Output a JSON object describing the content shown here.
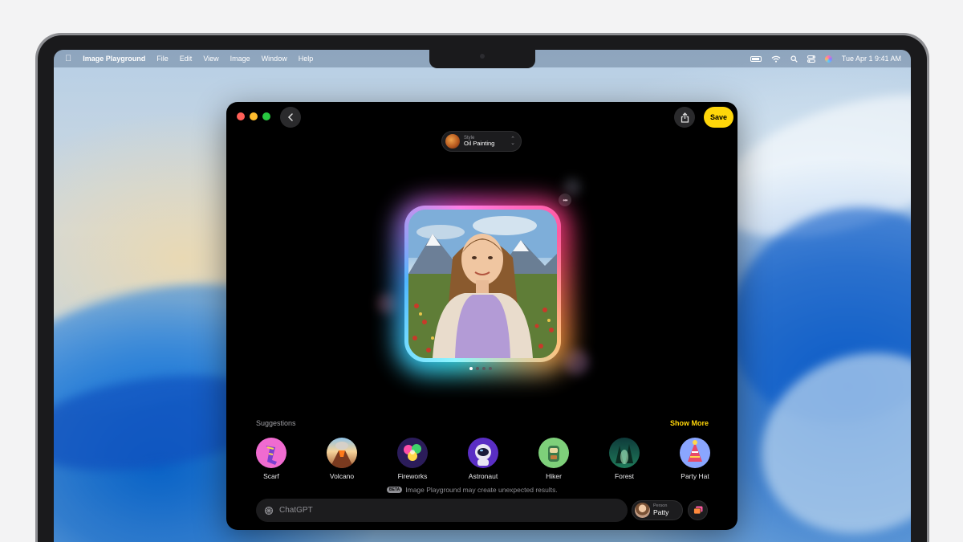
{
  "menubar": {
    "app_name": "Image Playground",
    "items": [
      "File",
      "Edit",
      "View",
      "Image",
      "Window",
      "Help"
    ],
    "datetime": "Tue Apr 1  9:41 AM"
  },
  "toolbar": {
    "save_label": "Save"
  },
  "style_picker": {
    "label": "Style",
    "value": "Oil Painting"
  },
  "carousel": {
    "page_count": 4,
    "active_index": 0
  },
  "suggestions": {
    "title": "Suggestions",
    "show_more": "Show More",
    "items": [
      {
        "label": "Scarf",
        "icon": "scarf-icon"
      },
      {
        "label": "Volcano",
        "icon": "volcano-icon"
      },
      {
        "label": "Fireworks",
        "icon": "fireworks-icon"
      },
      {
        "label": "Astronaut",
        "icon": "astronaut-icon"
      },
      {
        "label": "Hiker",
        "icon": "hiker-icon"
      },
      {
        "label": "Forest",
        "icon": "forest-icon"
      },
      {
        "label": "Party Hat",
        "icon": "party-hat-icon"
      }
    ]
  },
  "disclaimer": {
    "tag": "BETA",
    "text": "Image Playground may create unexpected results."
  },
  "prompt": {
    "placeholder": "ChatGPT"
  },
  "person": {
    "label": "Person",
    "name": "Patty"
  },
  "colors": {
    "accent": "#ffd60a",
    "window_bg": "#000000"
  }
}
